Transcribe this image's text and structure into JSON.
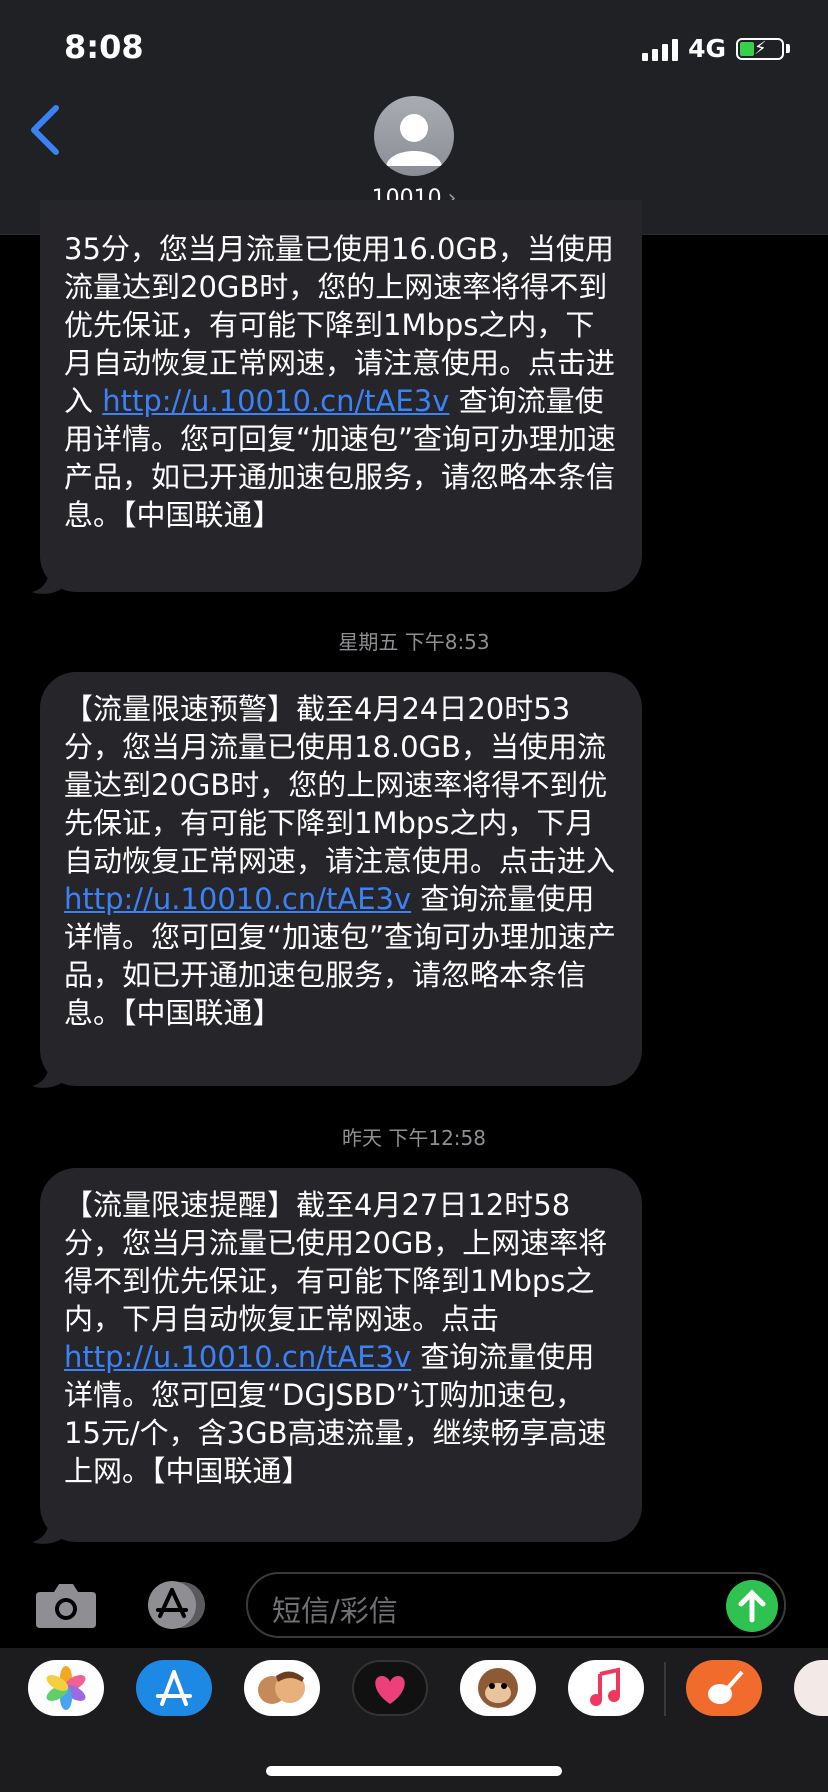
{
  "status": {
    "time": "8:08",
    "network": "4G"
  },
  "header": {
    "contact": "10010",
    "chevron": "›"
  },
  "messages": [
    {
      "lines_html_parts": [],
      "text_before": "35分，您当月流量已使用16.0GB，当使用流量达到20GB时，您的上网速率将得不到优先保证，有可能下降到1Mbps之内，下月自动恢复正常网速，请注意使用。点击进入 ",
      "link": "http://u.10010.cn/tAE3v",
      "text_after": " 查询流量使用详情。您可回复“加速包”查询可办理加速产品，如已开通加速包服务，请忽略本条信息。【中国联通】"
    },
    {
      "timestamp": "星期五 下午8:53",
      "text_before": "【流量限速预警】截至4月24日20时53分，您当月流量已使用18.0GB，当使用流量达到20GB时，您的上网速率将得不到优先保证，有可能下降到1Mbps之内，下月自动恢复正常网速，请注意使用。点击进入 ",
      "link": "http://u.10010.cn/tAE3v",
      "text_after": " 查询流量使用详情。您可回复“加速包”查询可办理加速产品，如已开通加速包服务，请忽略本条信息。【中国联通】"
    },
    {
      "timestamp": "昨天 下午12:58",
      "text_before": "【流量限速提醒】截至4月27日12时58分，您当月流量已使用20GB，上网速率将得不到优先保证，有可能下降到1Mbps之内，下月自动恢复正常网速。点击 ",
      "link": "http://u.10010.cn/tAE3v",
      "text_after": " 查询流量使用详情。您可回复“DGJSBD”订购加速包，15元/个，含3GB高速流量，继续畅享高速上网。【中国联通】"
    }
  ],
  "input": {
    "placeholder": "短信/彩信"
  },
  "dock": {
    "apps": [
      "photos-icon",
      "app-store-icon",
      "memoji-icon",
      "digital-touch-icon",
      "animoji-monkey-icon",
      "music-icon",
      "garageband-icon",
      "sticker-app-icon"
    ]
  },
  "colors": {
    "bubble": "#26262a",
    "link": "#3b82f6",
    "send": "#30c251",
    "header": "#1f2125"
  }
}
